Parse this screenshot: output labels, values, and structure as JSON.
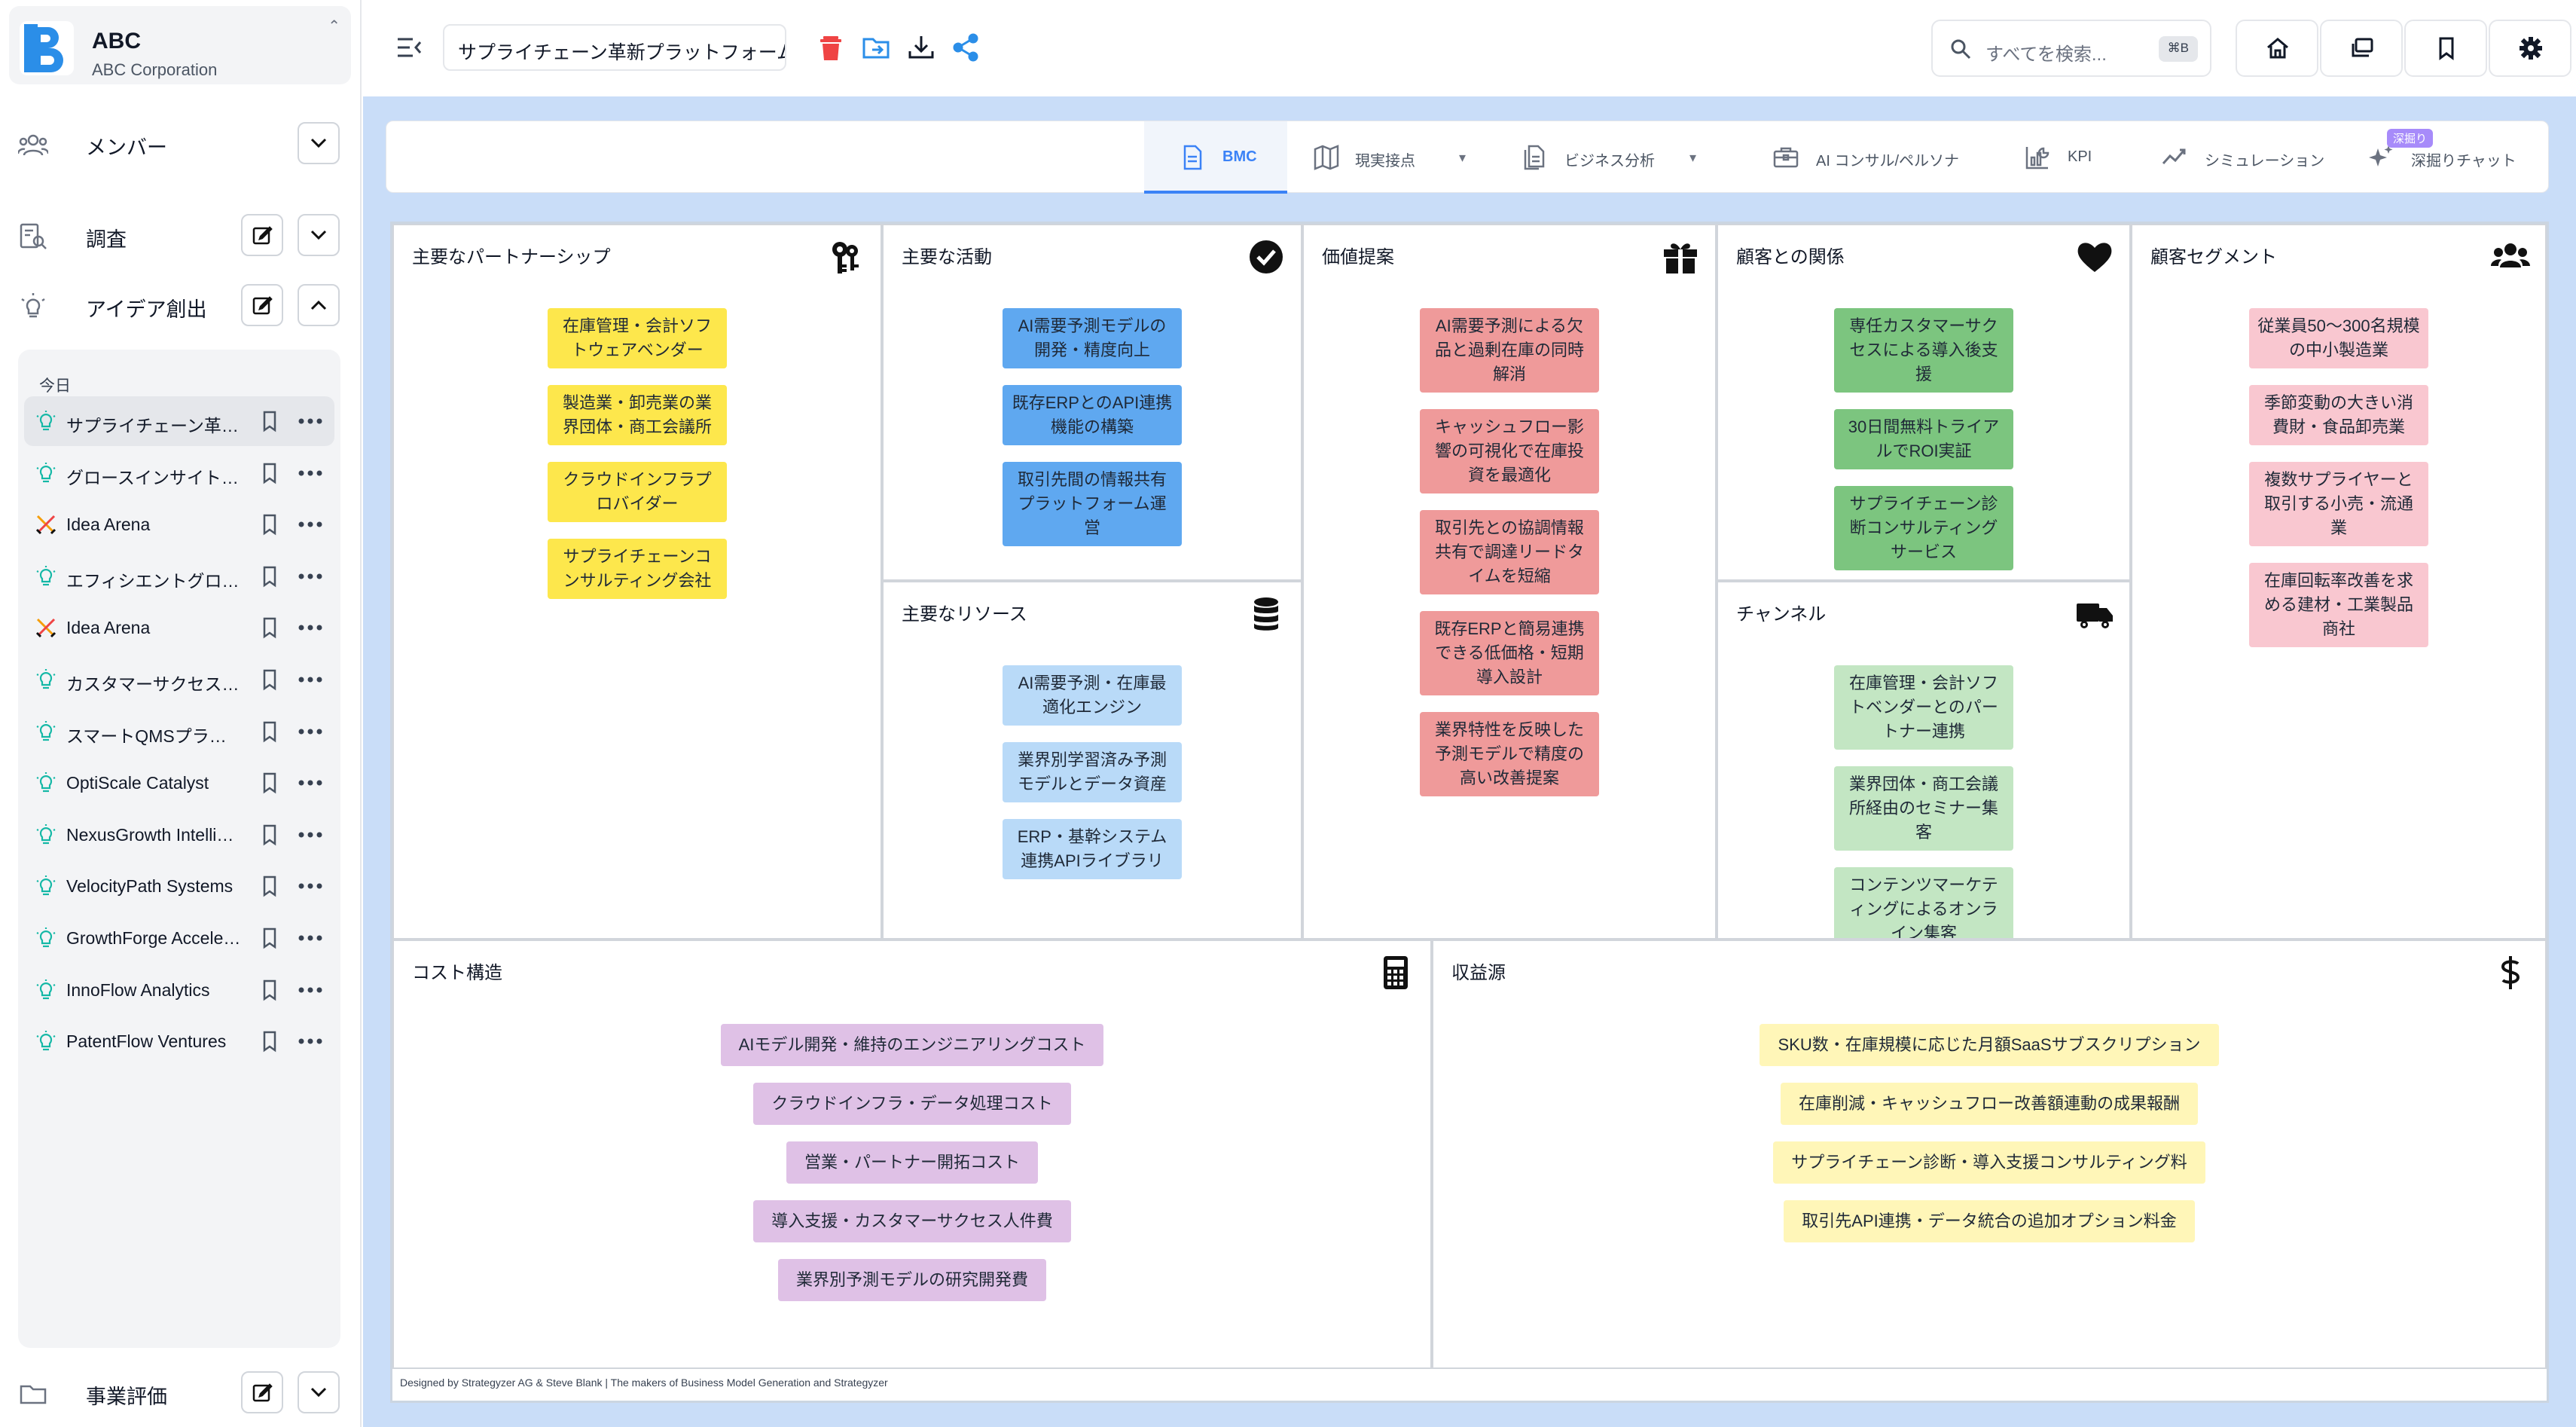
{
  "brand": {
    "title": "ABC",
    "subtitle": "ABC Corporation"
  },
  "nav": {
    "members": "メンバー",
    "research": "調査",
    "ideation": "アイデア創出",
    "evaluation": "事業評価"
  },
  "history": {
    "heading": "今日",
    "items": [
      {
        "label": "サプライチェーン革新プラットフォーム",
        "icon": "bulb"
      },
      {
        "label": "グロースインサイトラボ",
        "icon": "bulb"
      },
      {
        "label": "Idea Arena",
        "icon": "swords"
      },
      {
        "label": "エフィシエントグロース",
        "icon": "bulb"
      },
      {
        "label": "Idea Arena",
        "icon": "swords"
      },
      {
        "label": "カスタマーサクセスハブ",
        "icon": "bulb"
      },
      {
        "label": "スマートQMSプラットフォーム",
        "icon": "bulb"
      },
      {
        "label": "OptiScale Catalyst",
        "icon": "bulb"
      },
      {
        "label": "NexusGrowth Intelligence",
        "icon": "bulb"
      },
      {
        "label": "VelocityPath Systems",
        "icon": "bulb"
      },
      {
        "label": "GrowthForge Accelerator",
        "icon": "bulb"
      },
      {
        "label": "InnoFlow Analytics",
        "icon": "bulb"
      },
      {
        "label": "PatentFlow Ventures",
        "icon": "bulb"
      }
    ]
  },
  "header": {
    "title_value": "サプライチェーン革新プラットフォーム",
    "search_placeholder": "すべてを検索...",
    "search_shortcut": "⌘B"
  },
  "tabs": [
    {
      "label": "BMC"
    },
    {
      "label": "現実接点"
    },
    {
      "label": "ビジネス分析"
    },
    {
      "label": "AI コンサル/ペルソナ"
    },
    {
      "label": "KPI"
    },
    {
      "label": "シミュレーション"
    },
    {
      "label": "深掘りチャット",
      "badge": "深掘り"
    }
  ],
  "bmc": {
    "partners": {
      "title": "主要なパートナーシップ",
      "notes": [
        "在庫管理・会計ソフトウェアベンダー",
        "製造業・卸売業の業界団体・商工会議所",
        "クラウドインフラプロバイダー",
        "サプライチェーンコンサルティング会社"
      ]
    },
    "activities": {
      "title": "主要な活動",
      "notes": [
        "AI需要予測モデルの開発・精度向上",
        "既存ERPとのAPI連携機能の構築",
        "取引先間の情報共有プラットフォーム運営"
      ]
    },
    "resources": {
      "title": "主要なリソース",
      "notes": [
        "AI需要予測・在庫最適化エンジン",
        "業界別学習済み予測モデルとデータ資産",
        "ERP・基幹システム連携APIライブラリ"
      ]
    },
    "value": {
      "title": "価値提案",
      "notes": [
        "AI需要予測による欠品と過剰在庫の同時解消",
        "キャッシュフロー影響の可視化で在庫投資を最適化",
        "取引先との協調情報共有で調達リードタイムを短縮",
        "既存ERPと簡易連携できる低価格・短期導入設計",
        "業界特性を反映した予測モデルで精度の高い改善提案"
      ]
    },
    "relationships": {
      "title": "顧客との関係",
      "notes": [
        "専任カスタマーサクセスによる導入後支援",
        "30日間無料トライアルでROI実証",
        "サプライチェーン診断コンサルティングサービス"
      ]
    },
    "channels": {
      "title": "チャンネル",
      "notes": [
        "在庫管理・会計ソフトベンダーとのパートナー連携",
        "業界団体・商工会議所経由のセミナー集客",
        "コンテンツマーケティングによるオンライン集客"
      ]
    },
    "segments": {
      "title": "顧客セグメント",
      "notes": [
        "従業員50〜300名規模の中小製造業",
        "季節変動の大きい消費財・食品卸売業",
        "複数サプライヤーと取引する小売・流通業",
        "在庫回転率改善を求める建材・工業製品商社"
      ]
    },
    "cost": {
      "title": "コスト構造",
      "notes": [
        "AIモデル開発・維持のエンジニアリングコスト",
        "クラウドインフラ・データ処理コスト",
        "営業・パートナー開拓コスト",
        "導入支援・カスタマーサクセス人件費",
        "業界別予測モデルの研究開発費"
      ]
    },
    "revenue": {
      "title": "収益源",
      "notes": [
        "SKU数・在庫規模に応じた月額SaaSサブスクリプション",
        "在庫削減・キャッシュフロー改善額連動の成果報酬",
        "サプライチェーン診断・導入支援コンサルティング料",
        "取引先API連携・データ統合の追加オプション料金"
      ]
    },
    "footer": "Designed by Strategyzer AG & Steve Blank | The makers of Business Model Generation and Strategyzer"
  },
  "colors": {
    "accent": "#3b82f6",
    "danger": "#ef4444",
    "canvas_bg": "#c9ddf8"
  }
}
